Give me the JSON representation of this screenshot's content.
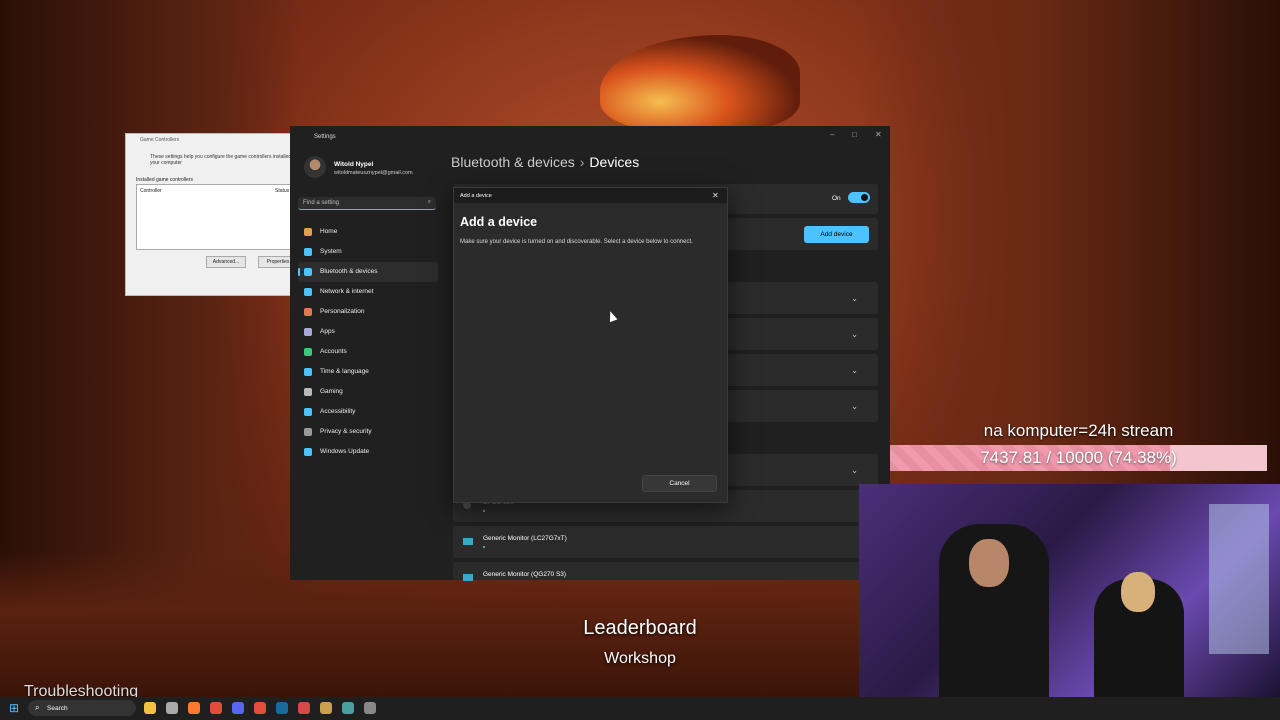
{
  "game_controllers": {
    "title": "Game Controllers",
    "description": "These settings help you configure the game controllers installed on your computer",
    "installed_label": "Installed game controllers",
    "columns": [
      "Controller",
      "Status"
    ],
    "buttons": [
      "Advanced...",
      "Properties"
    ]
  },
  "settings": {
    "window_title": "Settings",
    "profile": {
      "name": "Witold Nypel",
      "email": "witoldmateusznypel@gmail.com"
    },
    "search_placeholder": "Find a setting",
    "nav": [
      {
        "label": "Home",
        "color": "#e0a050"
      },
      {
        "label": "System",
        "color": "#4cc2ff"
      },
      {
        "label": "Bluetooth & devices",
        "color": "#4cc2ff"
      },
      {
        "label": "Network & internet",
        "color": "#4cc2ff"
      },
      {
        "label": "Personalization",
        "color": "#e07850"
      },
      {
        "label": "Apps",
        "color": "#a8a8d8"
      },
      {
        "label": "Accounts",
        "color": "#3cc878"
      },
      {
        "label": "Time & language",
        "color": "#4cc2ff"
      },
      {
        "label": "Gaming",
        "color": "#bbbbbb"
      },
      {
        "label": "Accessibility",
        "color": "#4cc2ff"
      },
      {
        "label": "Privacy & security",
        "color": "#999999"
      },
      {
        "label": "Windows Update",
        "color": "#4cc2ff"
      }
    ],
    "active_nav": "Bluetooth & devices",
    "breadcrumb": {
      "parent": "Bluetooth & devices",
      "separator": "›",
      "current": "Devices"
    },
    "bluetooth_toggle": {
      "label": "On",
      "state": true
    },
    "add_device_button": "Add device",
    "devices": [
      {
        "name": "EPOS 620"
      },
      {
        "name": "Generic Monitor (LC27G7xT)"
      },
      {
        "name": "Generic Monitor (QG270 S3)"
      }
    ]
  },
  "dialog": {
    "window_title": "Add a device",
    "heading": "Add a device",
    "message": "Make sure your device is turned on and discoverable. Select a device below to connect.",
    "cancel": "Cancel"
  },
  "stream": {
    "goal_title": "na komputer=24h stream",
    "goal_text": "7437.81 / 10000 (74.38%)",
    "goal_fraction": 0.7438,
    "overlay_leaderboard": "Leaderboard",
    "overlay_workshop": "Workshop",
    "overlay_troubleshooting": "Troubleshooting"
  },
  "taskbar": {
    "search": "Search",
    "icons": [
      {
        "name": "file-explorer-icon",
        "color": "#f0c040"
      },
      {
        "name": "store-icon",
        "color": "#aaaaaa"
      },
      {
        "name": "firefox-icon",
        "color": "#ff7a30"
      },
      {
        "name": "chrome-icon",
        "color": "#e44c3c"
      },
      {
        "name": "discord-icon",
        "color": "#5865f2"
      },
      {
        "name": "chrome-alt-icon",
        "color": "#e44c3c"
      },
      {
        "name": "steam-icon",
        "color": "#1b6a9c"
      },
      {
        "name": "app-icon",
        "color": "#d84a4a"
      },
      {
        "name": "app2-icon",
        "color": "#c8a050"
      },
      {
        "name": "app3-icon",
        "color": "#4aa0a0"
      },
      {
        "name": "settings-icon",
        "color": "#888888"
      }
    ]
  }
}
